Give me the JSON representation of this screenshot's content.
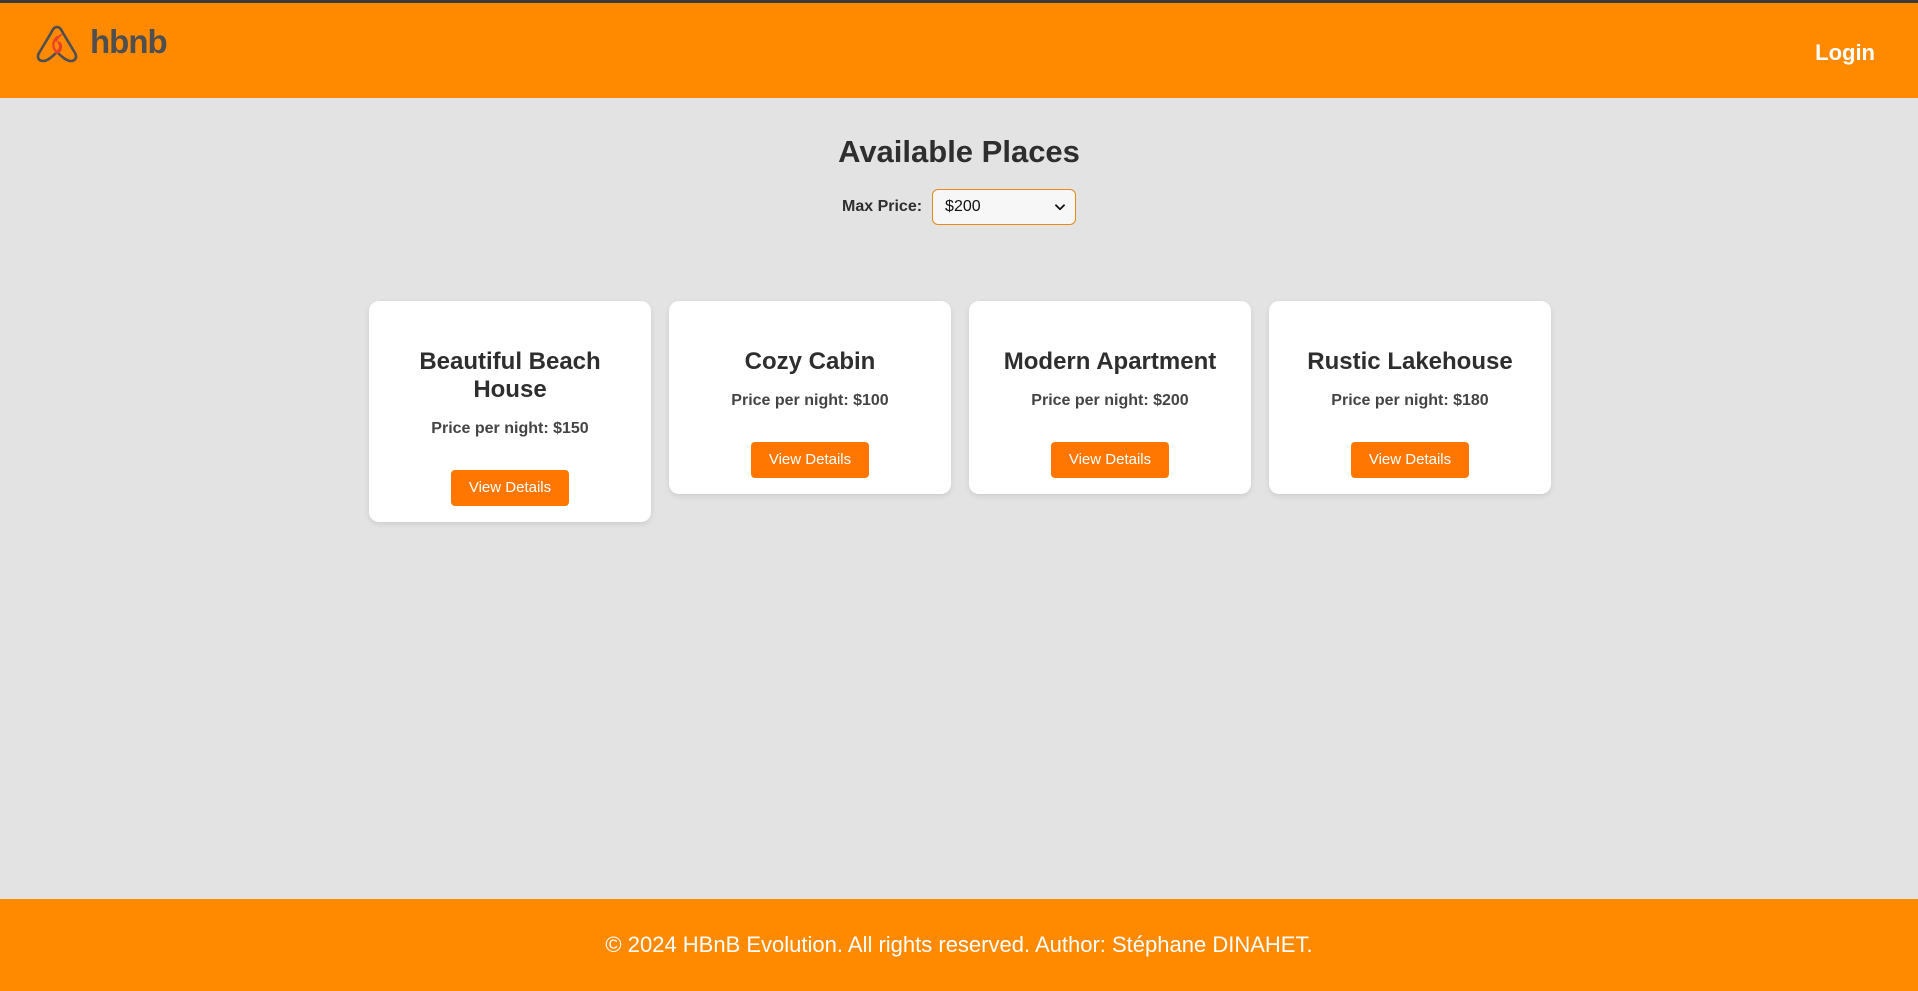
{
  "header": {
    "logo_text": "hbnb",
    "login_label": "Login"
  },
  "main": {
    "title": "Available Places",
    "filter": {
      "label": "Max Price:",
      "selected": "$200"
    },
    "places": [
      {
        "name": "Beautiful Beach House",
        "price": "Price per night: $150",
        "button": "View Details"
      },
      {
        "name": "Cozy Cabin",
        "price": "Price per night: $100",
        "button": "View Details"
      },
      {
        "name": "Modern Apartment",
        "price": "Price per night: $200",
        "button": "View Details"
      },
      {
        "name": "Rustic Lakehouse",
        "price": "Price per night: $180",
        "button": "View Details"
      }
    ]
  },
  "footer": {
    "text": "© 2024 HBnB Evolution. All rights reserved. Author: Stéphane DINAHET."
  },
  "colors": {
    "header_bg": "#ff8a00",
    "button_bg": "#ff7700",
    "page_bg": "#e3e3e4"
  },
  "icons": {
    "logo": "hbnb-logo-icon",
    "dropdown": "chevron-down-icon"
  }
}
